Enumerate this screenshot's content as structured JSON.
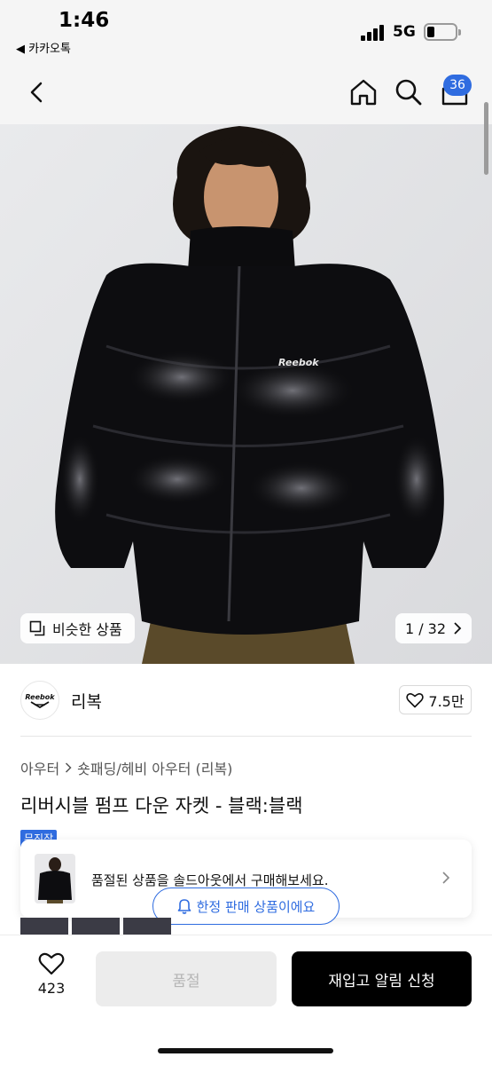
{
  "status_bar": {
    "time": "1:46",
    "back_app": "◀ 카카오톡",
    "network": "5G"
  },
  "nav": {
    "cart_count": "36"
  },
  "hero": {
    "similar_label": "비슷한 상품",
    "counter": "1 / 32",
    "logo_text": "Reebok"
  },
  "brand": {
    "logo_text": "Reebok",
    "name": "리복",
    "likes": "7.5만"
  },
  "breadcrumb": {
    "level1": "아우터",
    "level2": "숏패딩/헤비 아우터 (리복)"
  },
  "product": {
    "title": "리버시블 펌프 다운 자켓 - 블랙:블랙",
    "tag": "무진장"
  },
  "soldout_card": {
    "text": "품절된 상품을 솔드아웃에서 구매해보세요."
  },
  "toast": {
    "text": "한정 판매 상품이에요"
  },
  "bottom_bar": {
    "wish_count": "423",
    "soldout_label": "품절",
    "restock_label": "재입고 알림 신청"
  },
  "icons": {
    "back": "chevron-left-icon",
    "home": "home-icon",
    "search": "search-icon",
    "cart": "cart-icon",
    "similar": "copy-icon",
    "heart": "heart-icon",
    "bell": "bell-icon"
  },
  "colors": {
    "accent": "#2f6ce0",
    "primary_button": "#000000",
    "disabled_button": "#ececec"
  }
}
